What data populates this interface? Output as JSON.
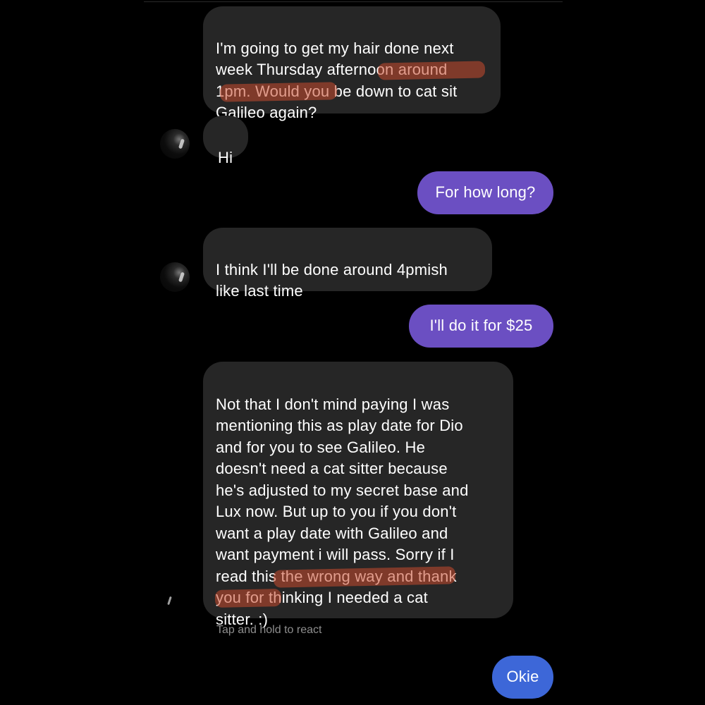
{
  "messages": [
    {
      "id": "m1",
      "direction": "incoming",
      "text": "I'm going to get my hair done next\nweek Thursday afternoon around\n1pm. Would you be down to cat sit\nGalileo again?",
      "highlighted_text": "own to cat sit Galileo again?"
    },
    {
      "id": "m2",
      "direction": "incoming",
      "text": "Hi"
    },
    {
      "id": "m3",
      "direction": "outgoing",
      "text": "For how long?"
    },
    {
      "id": "m4",
      "direction": "incoming",
      "text": "I think I'll be done around 4pmish\nlike last time"
    },
    {
      "id": "m5",
      "direction": "outgoing",
      "text": "I'll do it for $25"
    },
    {
      "id": "m6",
      "direction": "incoming",
      "text": "Not that I don't mind paying I was\nmentioning this as play date for Dio\nand for you to see Galileo. He\ndoesn't need a cat sitter because\nhe's adjusted to my secret base and\nLux now. But up to you if you don't\nwant a play date with Galileo and\nwant payment i will pass. Sorry if I\nread this the wrong way and thank\nyou for thinking I needed a cat\nsitter. :)",
      "highlighted_text": "inking I needed a cat sitter. :)"
    },
    {
      "id": "m7",
      "direction": "outgoing",
      "text": "Okie"
    }
  ],
  "react_hint": "Tap and hold to react",
  "colors": {
    "background": "#000000",
    "incoming_bubble": "#262626",
    "outgoing_purple": "#6b4fc2",
    "outgoing_blue": "#3d67d8",
    "highlight": "#c84b2d",
    "hint_text": "#8e8e8e"
  },
  "icons": [
    "contact-avatar"
  ]
}
